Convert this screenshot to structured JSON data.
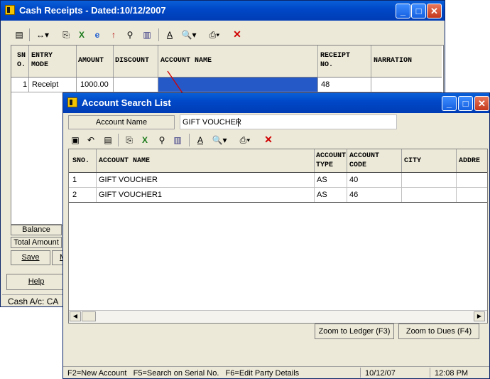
{
  "main_window": {
    "title": "Cash Receipts - Dated:10/12/2007",
    "columns": [
      "SN O.",
      "ENTRY MODE",
      "AMOUNT",
      "DISCOUNT",
      "ACCOUNT NAME",
      "RECEIPT NO.",
      "NARRATION"
    ],
    "row": {
      "sno": "1",
      "entry_mode": "Receipt",
      "amount": "1000.00",
      "receipt_no": "48"
    },
    "balance_label": "Balance",
    "total_amount_label": "Total Amount",
    "save_button": "Save",
    "m_button": "M",
    "help_button": "Help",
    "status": "Cash A/c: CA"
  },
  "search_window": {
    "title": "Account Search List",
    "account_name_label": "Account Name",
    "account_name_value": "GIFT VOUCHER",
    "columns": {
      "sno": "SNO.",
      "account_name": "ACCOUNT NAME",
      "account_type": "ACCOUNT TYPE",
      "account_code": "ACCOUNT CODE",
      "city": "CITY",
      "address": "ADDRE"
    },
    "rows": [
      {
        "sno": "1",
        "name": "GIFT VOUCHER",
        "type": "AS",
        "code": "40"
      },
      {
        "sno": "2",
        "name": "GIFT VOUCHER1",
        "type": "AS",
        "code": "46"
      }
    ],
    "zoom_ledger": "Zoom to Ledger (F3)",
    "zoom_dues": "Zoom to Dues (F4)",
    "status": {
      "help": "F2=New Account   F5=Search on Serial No.   F6=Edit Party Details",
      "date": "10/12/07",
      "time": "12:08 PM"
    }
  },
  "colors": {
    "selection": "#2659c8",
    "title_bar": "#0a5fd8",
    "close_button": "#c4381c",
    "arrow": "#d40000"
  }
}
